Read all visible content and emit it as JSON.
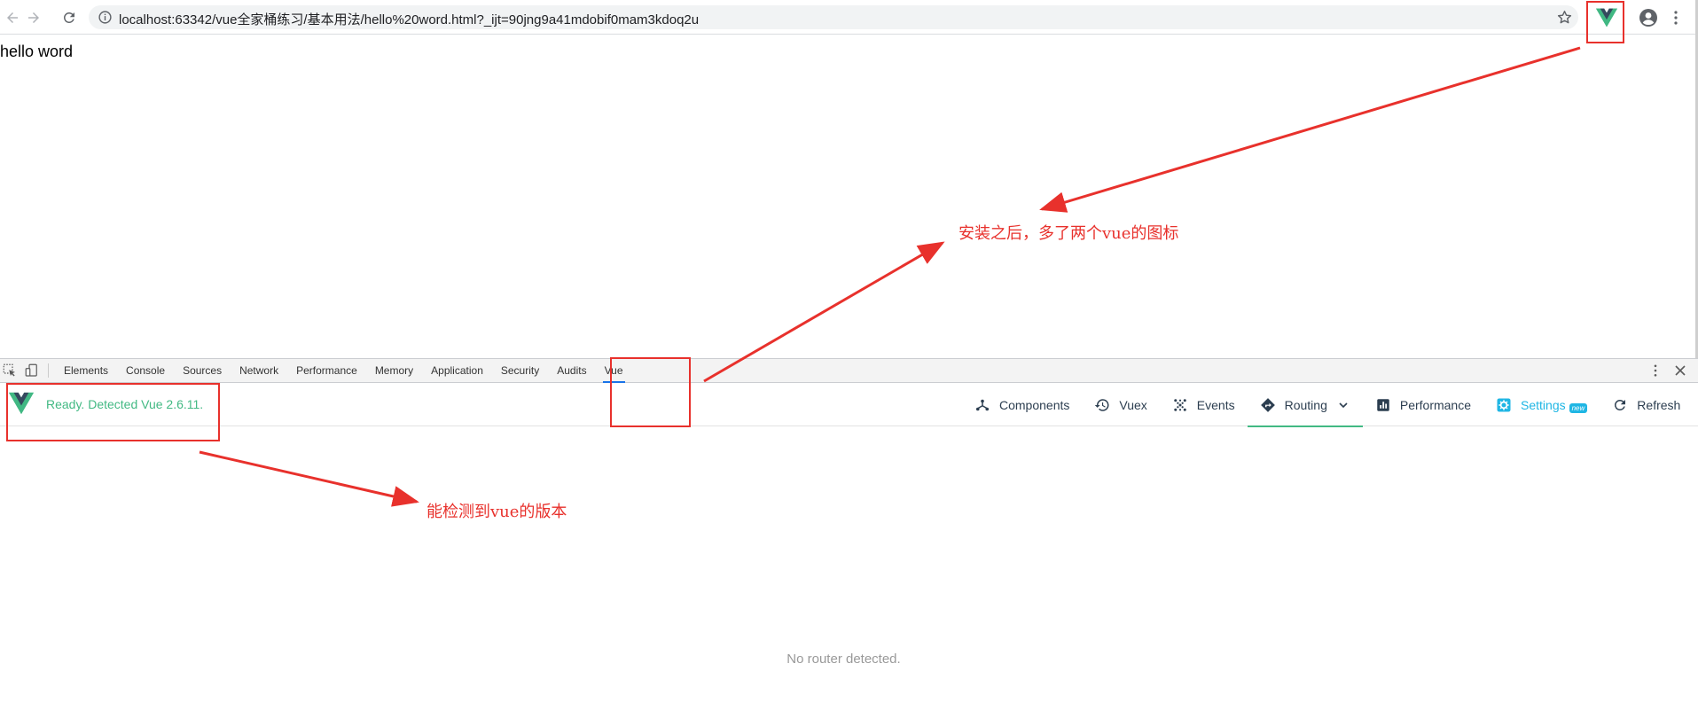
{
  "browser": {
    "url": "localhost:63342/vue全家桶练习/基本用法/hello%20word.html?_ijt=90jng9a41mdobif0mam3kdoq2u"
  },
  "page": {
    "text": "hello word"
  },
  "devtools": {
    "tabs": [
      "Elements",
      "Console",
      "Sources",
      "Network",
      "Performance",
      "Memory",
      "Application",
      "Security",
      "Audits",
      "Vue"
    ],
    "active_tab": "Vue",
    "vue": {
      "status": "Ready. Detected Vue 2.6.11.",
      "nav": {
        "components": "Components",
        "vuex": "Vuex",
        "events": "Events",
        "routing": "Routing",
        "performance": "Performance",
        "settings": "Settings",
        "settings_badge": "new",
        "refresh": "Refresh"
      },
      "active_nav": "Routing",
      "empty_message": "No router detected."
    }
  },
  "annotations": {
    "note_icon": "安装之后，多了两个vue的图标",
    "note_version": "能检测到vue的版本",
    "color": "#e8312c"
  },
  "colors": {
    "vue_green": "#42b983",
    "vue_dark": "#35495e",
    "settings_blue": "#1fb6e4"
  }
}
